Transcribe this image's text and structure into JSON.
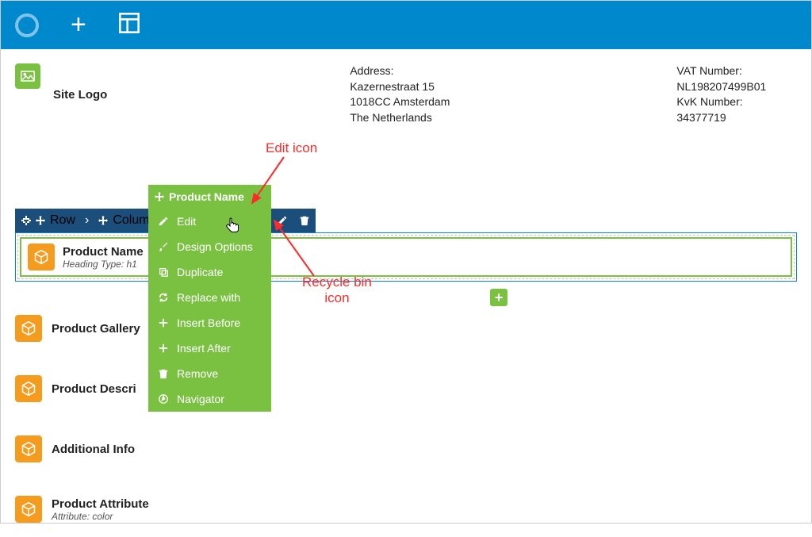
{
  "topbar": {
    "logo_name": "circle-logo",
    "plus_name": "add-icon",
    "layout_name": "layout-icon"
  },
  "header": {
    "site_logo_label": "Site Logo",
    "address": {
      "label": "Address:",
      "line1": "Kazernestraat 15",
      "line2": "1018CC Amsterdam",
      "line3": "The Netherlands"
    },
    "vat": {
      "label": "VAT Number:",
      "value": "NL198207499B01",
      "kvk_label": "KvK Number:",
      "kvk_value": "34377719"
    }
  },
  "breadcrumb": {
    "row": "Row",
    "column": "Column",
    "product_name": "Product Name"
  },
  "blocks": {
    "product_name": {
      "title": "Product Name",
      "sub": "Heading Type: h1"
    },
    "gallery": {
      "title": "Product Gallery"
    },
    "description": {
      "title": "Product Descri"
    },
    "additional": {
      "title": "Additional Info"
    },
    "attribute": {
      "title": "Product Attribute",
      "sub": "Attribute: color"
    }
  },
  "context_menu": {
    "header": "Product Name",
    "items": [
      {
        "icon": "pencil-icon",
        "label": "Edit"
      },
      {
        "icon": "brush-icon",
        "label": "Design Options"
      },
      {
        "icon": "duplicate-icon",
        "label": "Duplicate"
      },
      {
        "icon": "refresh-icon",
        "label": "Replace with"
      },
      {
        "icon": "plus-icon",
        "label": "Insert Before"
      },
      {
        "icon": "plus-icon",
        "label": "Insert After"
      },
      {
        "icon": "trash-icon",
        "label": "Remove"
      },
      {
        "icon": "navigator-icon",
        "label": "Navigator"
      }
    ]
  },
  "annotations": {
    "edit": "Edit icon",
    "bin1": "Recycle bin",
    "bin2": "icon"
  },
  "colors": {
    "topbar": "#0088cc",
    "green": "#7ac142",
    "navy": "#1b4e7a",
    "orange": "#f59b1e",
    "anno": "#ff2a2a"
  }
}
